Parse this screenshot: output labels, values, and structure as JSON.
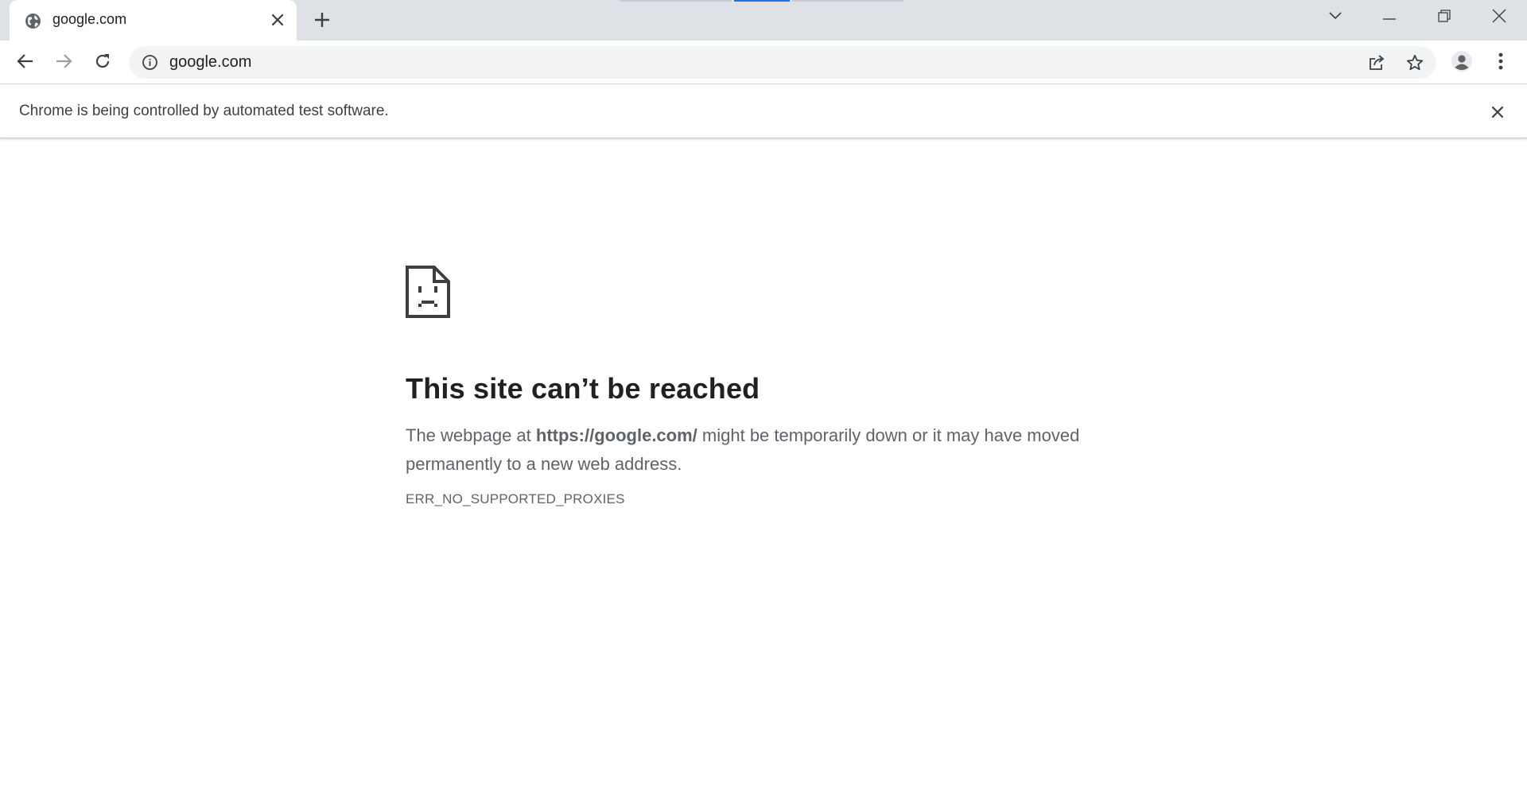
{
  "browser": {
    "tab": {
      "title": "google.com",
      "favicon": "globe-icon"
    },
    "new_tab_icon": "plus-icon",
    "window_controls": [
      "chevron-down-icon",
      "minimize-icon",
      "restore-icon",
      "close-icon"
    ],
    "address_bar": {
      "value": "google.com",
      "site_info_icon": "info-icon"
    },
    "nav_icons": [
      "back-arrow-icon",
      "forward-arrow-icon",
      "reload-icon"
    ],
    "omnibox_actions": [
      "share-icon",
      "bookmark-star-icon"
    ],
    "profile_icon": "avatar-icon",
    "menu_icon": "kebab-menu-icon"
  },
  "infobar": {
    "message": "Chrome is being controlled by automated test software.",
    "close_icon": "close-icon"
  },
  "error_page": {
    "icon": "sad-document-icon",
    "title": "This site can’t be reached",
    "desc_prefix": "The webpage at ",
    "desc_url": "https://google.com/",
    "desc_suffix": " might be temporarily down or it may have moved permanently to a new web address.",
    "error_code": "ERR_NO_SUPPORTED_PROXIES"
  },
  "colors": {
    "tabstrip_bg": "#dee1e6",
    "omnibox_bg": "#f1f3f4",
    "loading_accent": "#1a73e8",
    "text_primary": "#202124",
    "text_secondary": "#5f6368"
  }
}
